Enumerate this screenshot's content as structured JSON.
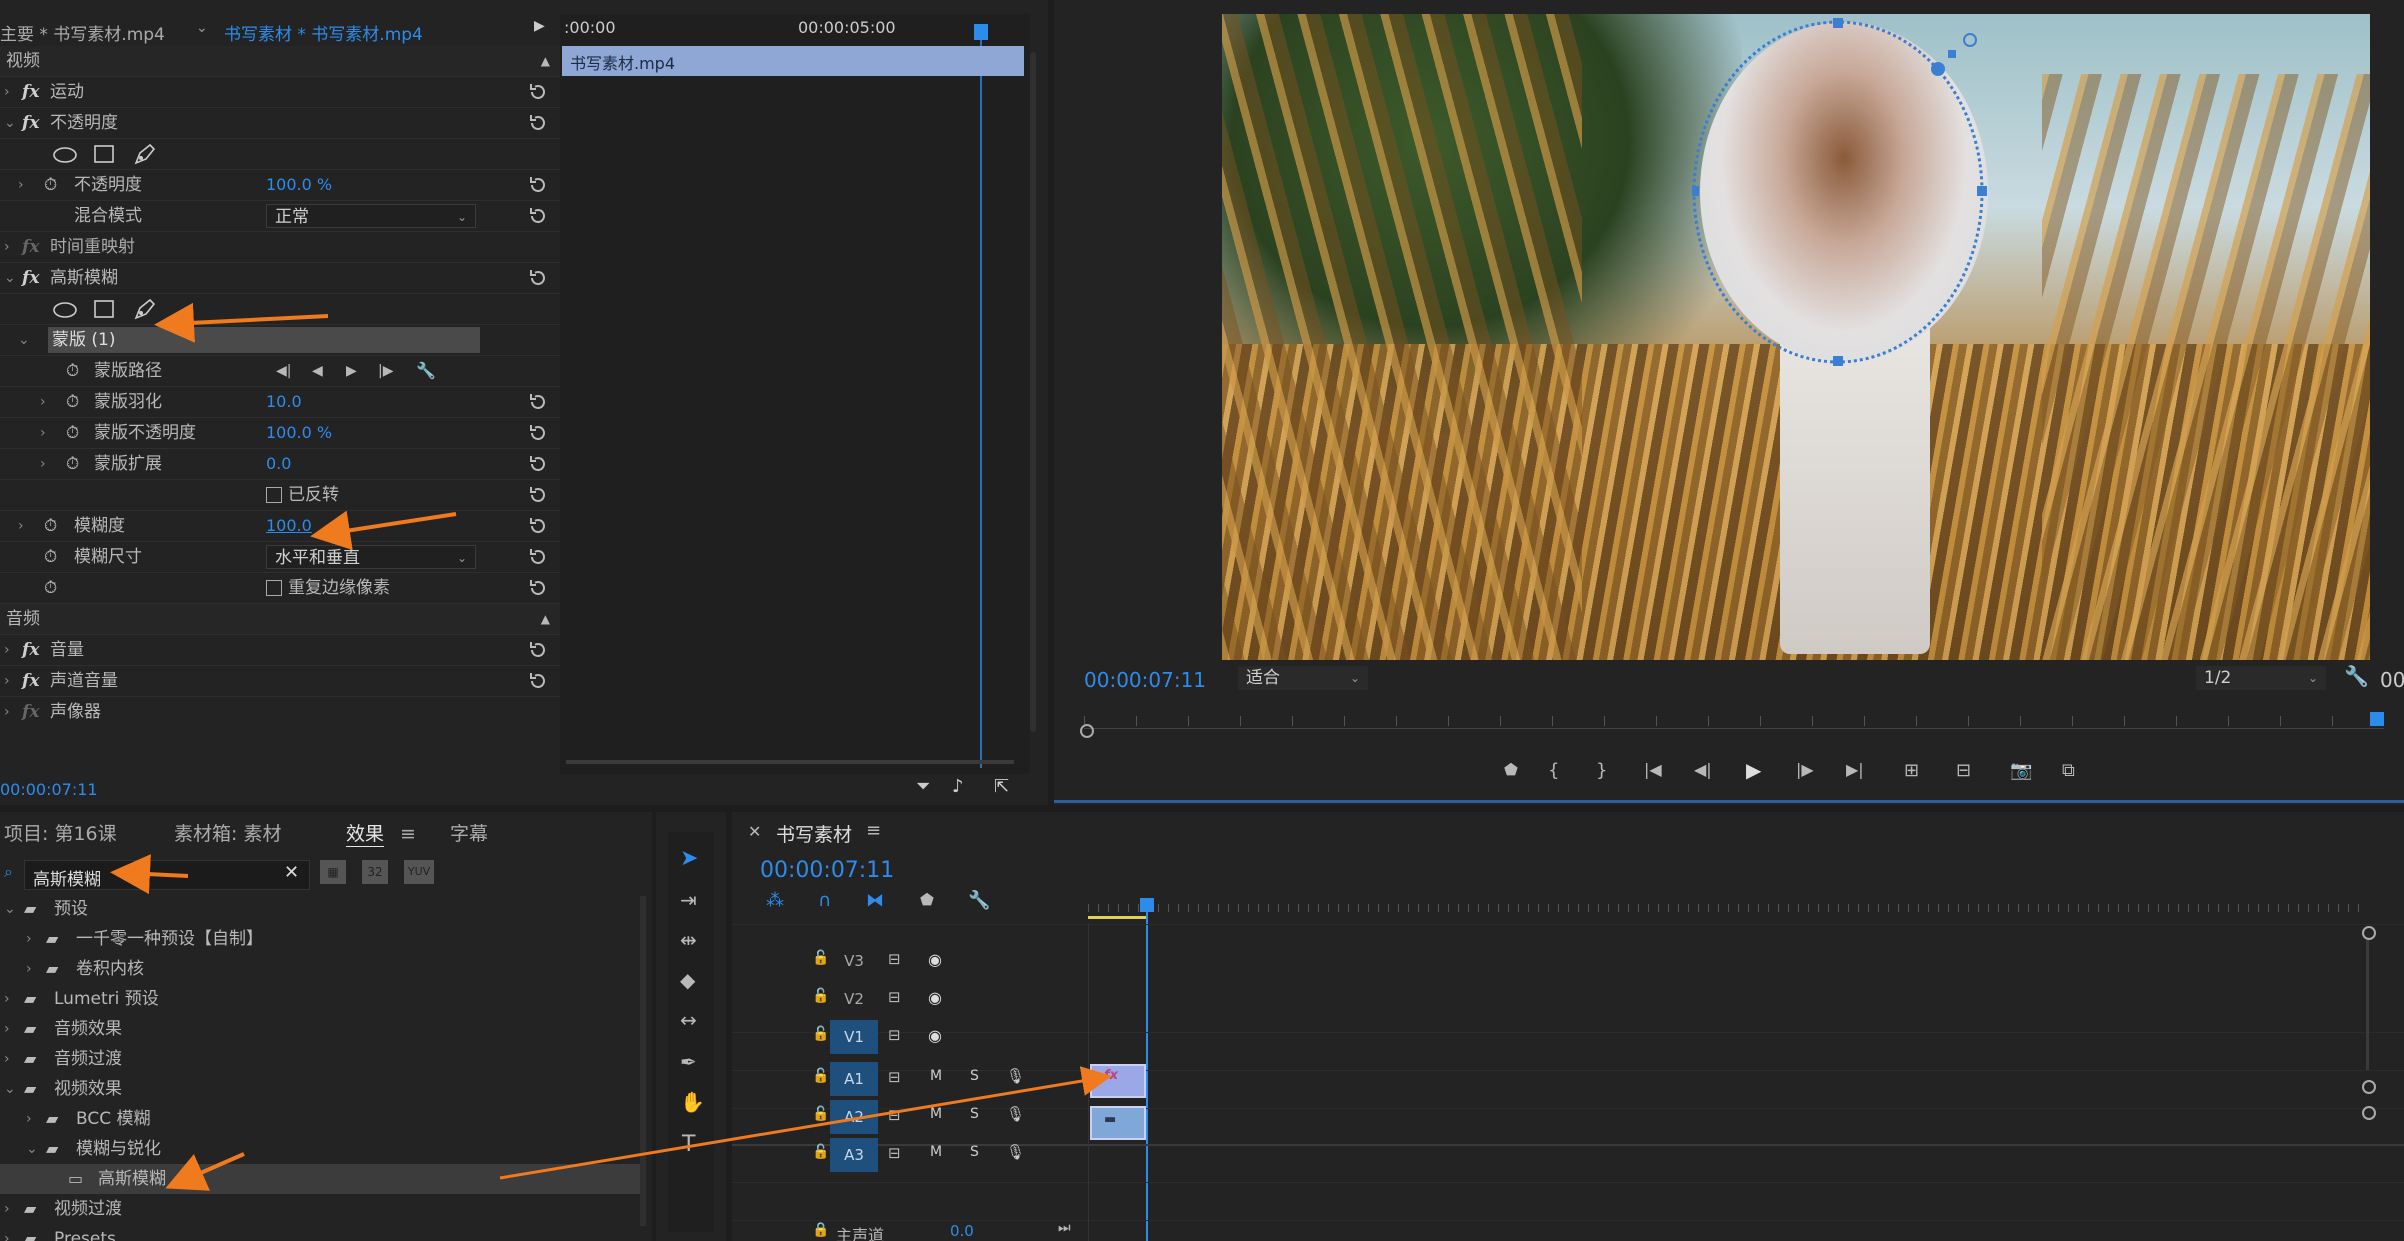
{
  "effect_controls": {
    "tab_master": "主要 * 书写素材.mp4",
    "tab_clip": "书写素材 * 书写素材.mp4",
    "mini_ruler": {
      "t0": ":00:00",
      "t1": "00:00:05:00"
    },
    "clip_label": "书写素材.mp4",
    "section_video": "视频",
    "motion": "运动",
    "opacity": "不透明度",
    "opacity_prop": "不透明度",
    "opacity_value": "100.0 %",
    "blend_mode_label": "混合模式",
    "blend_mode_value": "正常",
    "time_remap": "时间重映射",
    "gaussian_blur": "高斯模糊",
    "mask_name": "蒙版 (1)",
    "mask_path": "蒙版路径",
    "mask_feather": "蒙版羽化",
    "mask_feather_value": "10.0",
    "mask_opacity": "蒙版不透明度",
    "mask_opacity_value": "100.0 %",
    "mask_expansion": "蒙版扩展",
    "mask_expansion_value": "0.0",
    "inverted": "已反转",
    "blurriness": "模糊度",
    "blurriness_value": "100.0",
    "blur_dims_label": "模糊尺寸",
    "blur_dims_value": "水平和垂直",
    "repeat_edge": "重复边缘像素",
    "section_audio": "音频",
    "volume": "音量",
    "channel_volume": "声道音量",
    "panner": "声像器",
    "timecode": "00:00:07:11"
  },
  "program_monitor": {
    "timecode": "00:00:07:11",
    "fit_value": "适合",
    "resolution_value": "1/2",
    "duration_partial": "00"
  },
  "project_panel": {
    "tabs": [
      "项目: 第16课",
      "素材箱: 素材",
      "效果",
      "字幕"
    ],
    "active_tab": "效果",
    "search_value": "高斯模糊",
    "tree": [
      {
        "label": "预设",
        "indent": 0,
        "open": true
      },
      {
        "label": "一千零一种预设【自制】",
        "indent": 1
      },
      {
        "label": "卷积内核",
        "indent": 1
      },
      {
        "label": "Lumetri 预设",
        "indent": 0
      },
      {
        "label": "音频效果",
        "indent": 0
      },
      {
        "label": "音频过渡",
        "indent": 0
      },
      {
        "label": "视频效果",
        "indent": 0,
        "open": true
      },
      {
        "label": "BCC 模糊",
        "indent": 1
      },
      {
        "label": "模糊与锐化",
        "indent": 1,
        "open": true
      },
      {
        "label": "高斯模糊",
        "indent": 2,
        "selected": true
      },
      {
        "label": "视频过渡",
        "indent": 0
      },
      {
        "label": "Presets",
        "indent": 0
      }
    ]
  },
  "timeline": {
    "sequence_name": "书写素材",
    "timecode": "00:00:07:11",
    "tracks": [
      {
        "name": "V3",
        "type": "video"
      },
      {
        "name": "V2",
        "type": "video"
      },
      {
        "name": "V1",
        "type": "video",
        "active": true
      },
      {
        "name": "A1",
        "type": "audio",
        "active": true
      },
      {
        "name": "A2",
        "type": "audio",
        "active": true
      },
      {
        "name": "A3",
        "type": "audio",
        "active": true
      }
    ],
    "mute_label": "M",
    "solo_label": "S",
    "master_label": "主声道",
    "master_value": "0.0"
  },
  "colors": {
    "accent_blue": "#2d8ceb",
    "arrow_orange": "#f07a1e",
    "panel_bg": "#232323"
  }
}
